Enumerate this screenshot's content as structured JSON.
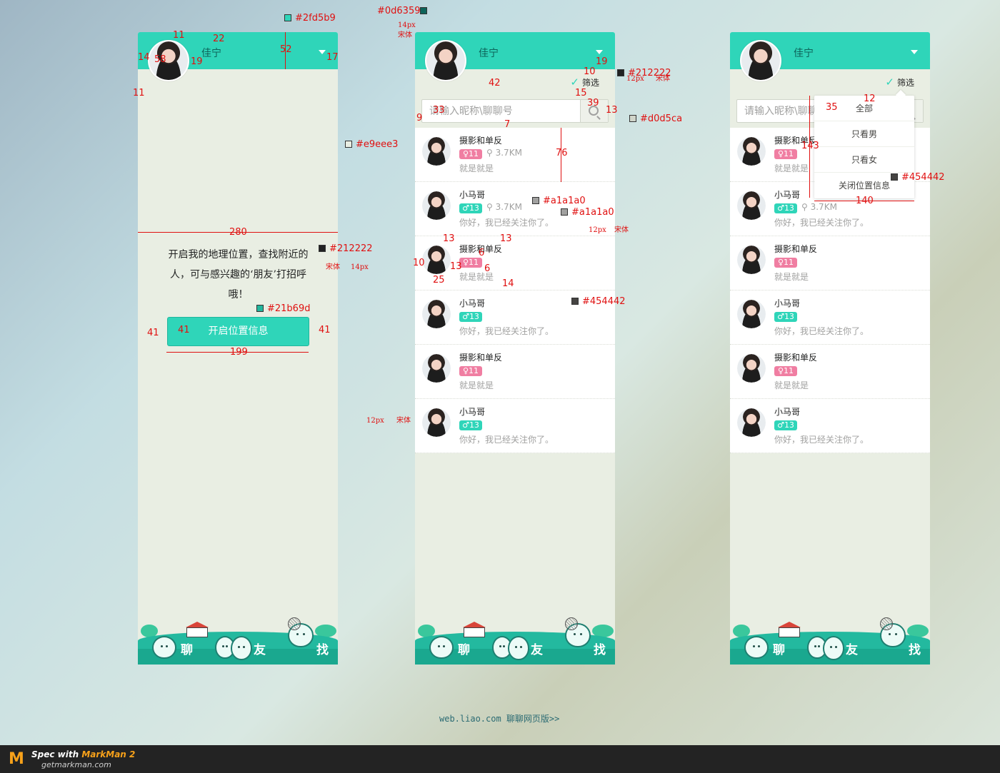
{
  "user": {
    "name": "佳宁"
  },
  "panel1": {
    "intro": "开启我的地理位置，查找附近的人，可与感兴趣的‘朋友’打招呼哦！",
    "button": "开启位置信息"
  },
  "filter": {
    "label": "筛选"
  },
  "search": {
    "placeholder": "请输入昵称\\聊聊号"
  },
  "list": [
    {
      "name": "摄影和单反",
      "gender": "♀",
      "age": "11",
      "distance": "3.7KM",
      "message": "就是就是"
    },
    {
      "name": "小马哥",
      "gender": "♂",
      "age": "13",
      "distance": "3.7KM",
      "message": "你好，我已经关注你了。"
    },
    {
      "name": "摄影和单反",
      "gender": "♀",
      "age": "11",
      "distance": "",
      "message": "就是就是"
    },
    {
      "name": "小马哥",
      "gender": "♂",
      "age": "13",
      "distance": "",
      "message": "你好，我已经关注你了。"
    },
    {
      "name": "摄影和单反",
      "gender": "♀",
      "age": "11",
      "distance": "",
      "message": "就是就是"
    },
    {
      "name": "小马哥",
      "gender": "♂",
      "age": "13",
      "distance": "",
      "message": "你好，我已经关注你了。"
    }
  ],
  "dropdown": [
    "全部",
    "只看男",
    "只看女",
    "关闭位置信息"
  ],
  "footer": {
    "chat": "聊",
    "friends": "友",
    "find": "找"
  },
  "web_link": "web.liao.com 聊聊网页版>>",
  "brand": {
    "spec": "Spec with",
    "product": "MarkMan 2",
    "site": "getmarkman.com"
  },
  "annotations": {
    "colors": {
      "header": "#2fd5b9",
      "name_text": "#0d6359",
      "background": "#e9eee3",
      "body_text": "#212222",
      "button_border": "#21b69d",
      "search_border": "#d0d5ca",
      "grey_text": "#a1a1a0",
      "dropdown_text": "#454442"
    },
    "font_serif": "宋体",
    "font_14": "14px",
    "font_12": "12px",
    "dims": [
      "11",
      "22",
      "14",
      "58",
      "19",
      "52",
      "17",
      "11",
      "280",
      "41",
      "41",
      "41",
      "199",
      "42",
      "10",
      "19",
      "15",
      "39",
      "13",
      "33",
      "9",
      "7",
      "76",
      "13",
      "13",
      "10",
      "13",
      "6",
      "6",
      "25",
      "14",
      "12",
      "35",
      "143",
      "140"
    ]
  }
}
